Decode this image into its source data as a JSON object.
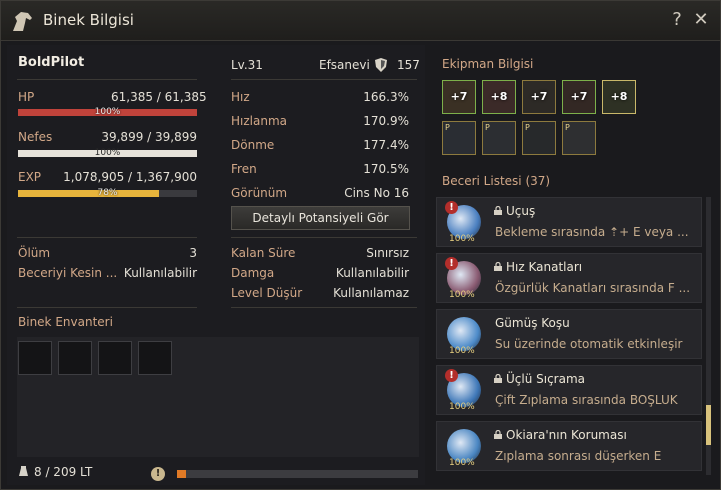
{
  "window": {
    "title": "Binek Bilgisi",
    "help_label": "?",
    "close_label": "✕"
  },
  "mount": {
    "name": "BoldPilot",
    "level": "Lv.31",
    "grade": "Efsanevi",
    "grade_value": "157",
    "hp": {
      "label": "HP",
      "value": "61,385 / 61,385",
      "percent_text": "100%",
      "fraction": 1.0,
      "color": "#c0433b"
    },
    "stamina": {
      "label": "Nefes",
      "value": "39,899 / 39,899",
      "percent_text": "100%",
      "fraction": 1.0,
      "color": "#e6e2da"
    },
    "exp": {
      "label": "EXP",
      "value": "1,078,905 / 1,367,900",
      "percent_text": "78%",
      "fraction": 0.7887,
      "color": "#e7b43c"
    }
  },
  "stats": [
    {
      "label": "Hız",
      "value": "166.3%"
    },
    {
      "label": "Hızlanma",
      "value": "170.9%"
    },
    {
      "label": "Dönme",
      "value": "177.4%"
    },
    {
      "label": "Fren",
      "value": "170.5%"
    }
  ],
  "appearance": {
    "label": "Görünüm",
    "value": "Cins No 16"
  },
  "detail_button": "Detaylı Potansiyeli Gör",
  "info_left": [
    {
      "label": "Ölüm",
      "value": "3"
    },
    {
      "label": "Beceriyi Kesin ...",
      "value": "Kullanılabilir"
    }
  ],
  "info_right": [
    {
      "label": "Kalan Süre",
      "value": "Sınırsız"
    },
    {
      "label": "Damga",
      "value": "Kullanılabilir"
    },
    {
      "label": "Level Düşür",
      "value": "Kullanılamaz"
    }
  ],
  "inventory": {
    "title": "Binek Envanteri",
    "weight": "8 / 209 LT",
    "weight_fraction": 0.038,
    "warn_label": "!"
  },
  "equipment": {
    "title": "Ekipman Bilgisi",
    "row1": [
      {
        "name": "saddle",
        "enh": "+7"
      },
      {
        "name": "stirrups",
        "enh": "+8"
      },
      {
        "name": "barding",
        "enh": "+7"
      },
      {
        "name": "horseshoe",
        "enh": "+7"
      },
      {
        "name": "ring",
        "enh": "+8"
      }
    ],
    "row2": [
      {
        "name": "armor",
        "p": "P"
      },
      {
        "name": "saddle-cosmetic",
        "p": "P"
      },
      {
        "name": "stirrup-cosmetic",
        "p": "P"
      },
      {
        "name": "mask",
        "p": "P"
      }
    ]
  },
  "skills": {
    "title": "Beceri Listesi (37)",
    "items": [
      {
        "name": "Uçuş",
        "desc": "Bekleme sırasında ⇡+ E veya ...",
        "pct": "100%",
        "alert": true,
        "locked": true,
        "color": "#4a7fc0"
      },
      {
        "name": "Hız Kanatları",
        "desc": "Özgürlük Kanatları sırasında F ...",
        "pct": "100%",
        "alert": true,
        "locked": true,
        "color": "#8a5b72"
      },
      {
        "name": "Gümüş Koşu",
        "desc": "Su üzerinde otomatik etkinleşir",
        "pct": "100%",
        "alert": false,
        "locked": false,
        "color": "#4d8bc9"
      },
      {
        "name": "Üçlü Sıçrama",
        "desc": "Çift Zıplama sırasında BOŞLUK",
        "pct": "100%",
        "alert": true,
        "locked": true,
        "color": "#3f78b8"
      },
      {
        "name": "Okiara'nın Koruması",
        "desc": "Zıplama sonrası düşerken E",
        "pct": "100%",
        "alert": false,
        "locked": true,
        "color": "#4a86c2"
      }
    ]
  }
}
